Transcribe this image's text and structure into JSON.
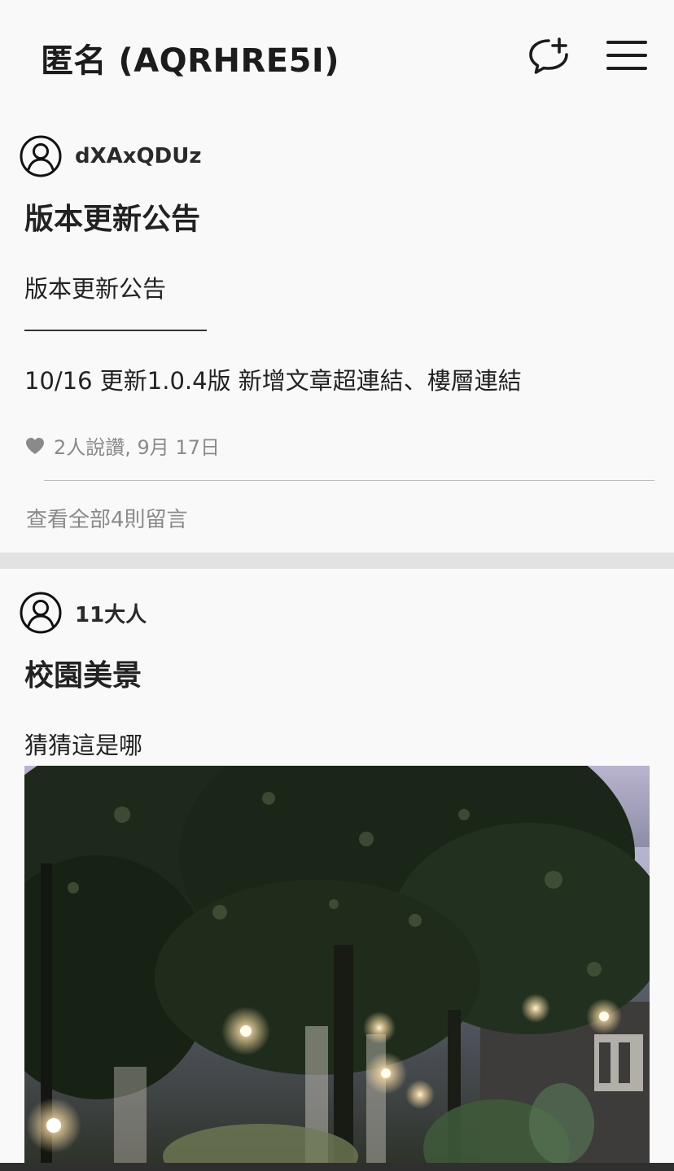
{
  "header": {
    "title": "匿名 (AQRHRE5I)",
    "new_chat_icon": "chat-bubble-plus-icon",
    "menu_icon": "hamburger-menu-icon"
  },
  "posts": [
    {
      "author": "dXAxQDUz",
      "title": "版本更新公告",
      "lines": [
        "版本更新公告",
        "10/16 更新1.0.4版 新增文章超連結、樓層連結"
      ],
      "likes_meta": "2人說讚, 9月 17日",
      "view_comments": "查看全部4則留言"
    },
    {
      "author": "11大人",
      "title": "校園美景",
      "lines": [
        "猜猜這是哪"
      ],
      "image": "night-campus-trees-photo"
    }
  ],
  "colors": {
    "background": "#f9f9f9",
    "separator": "#e2e2e2",
    "muted_text": "#8a8a8a"
  }
}
